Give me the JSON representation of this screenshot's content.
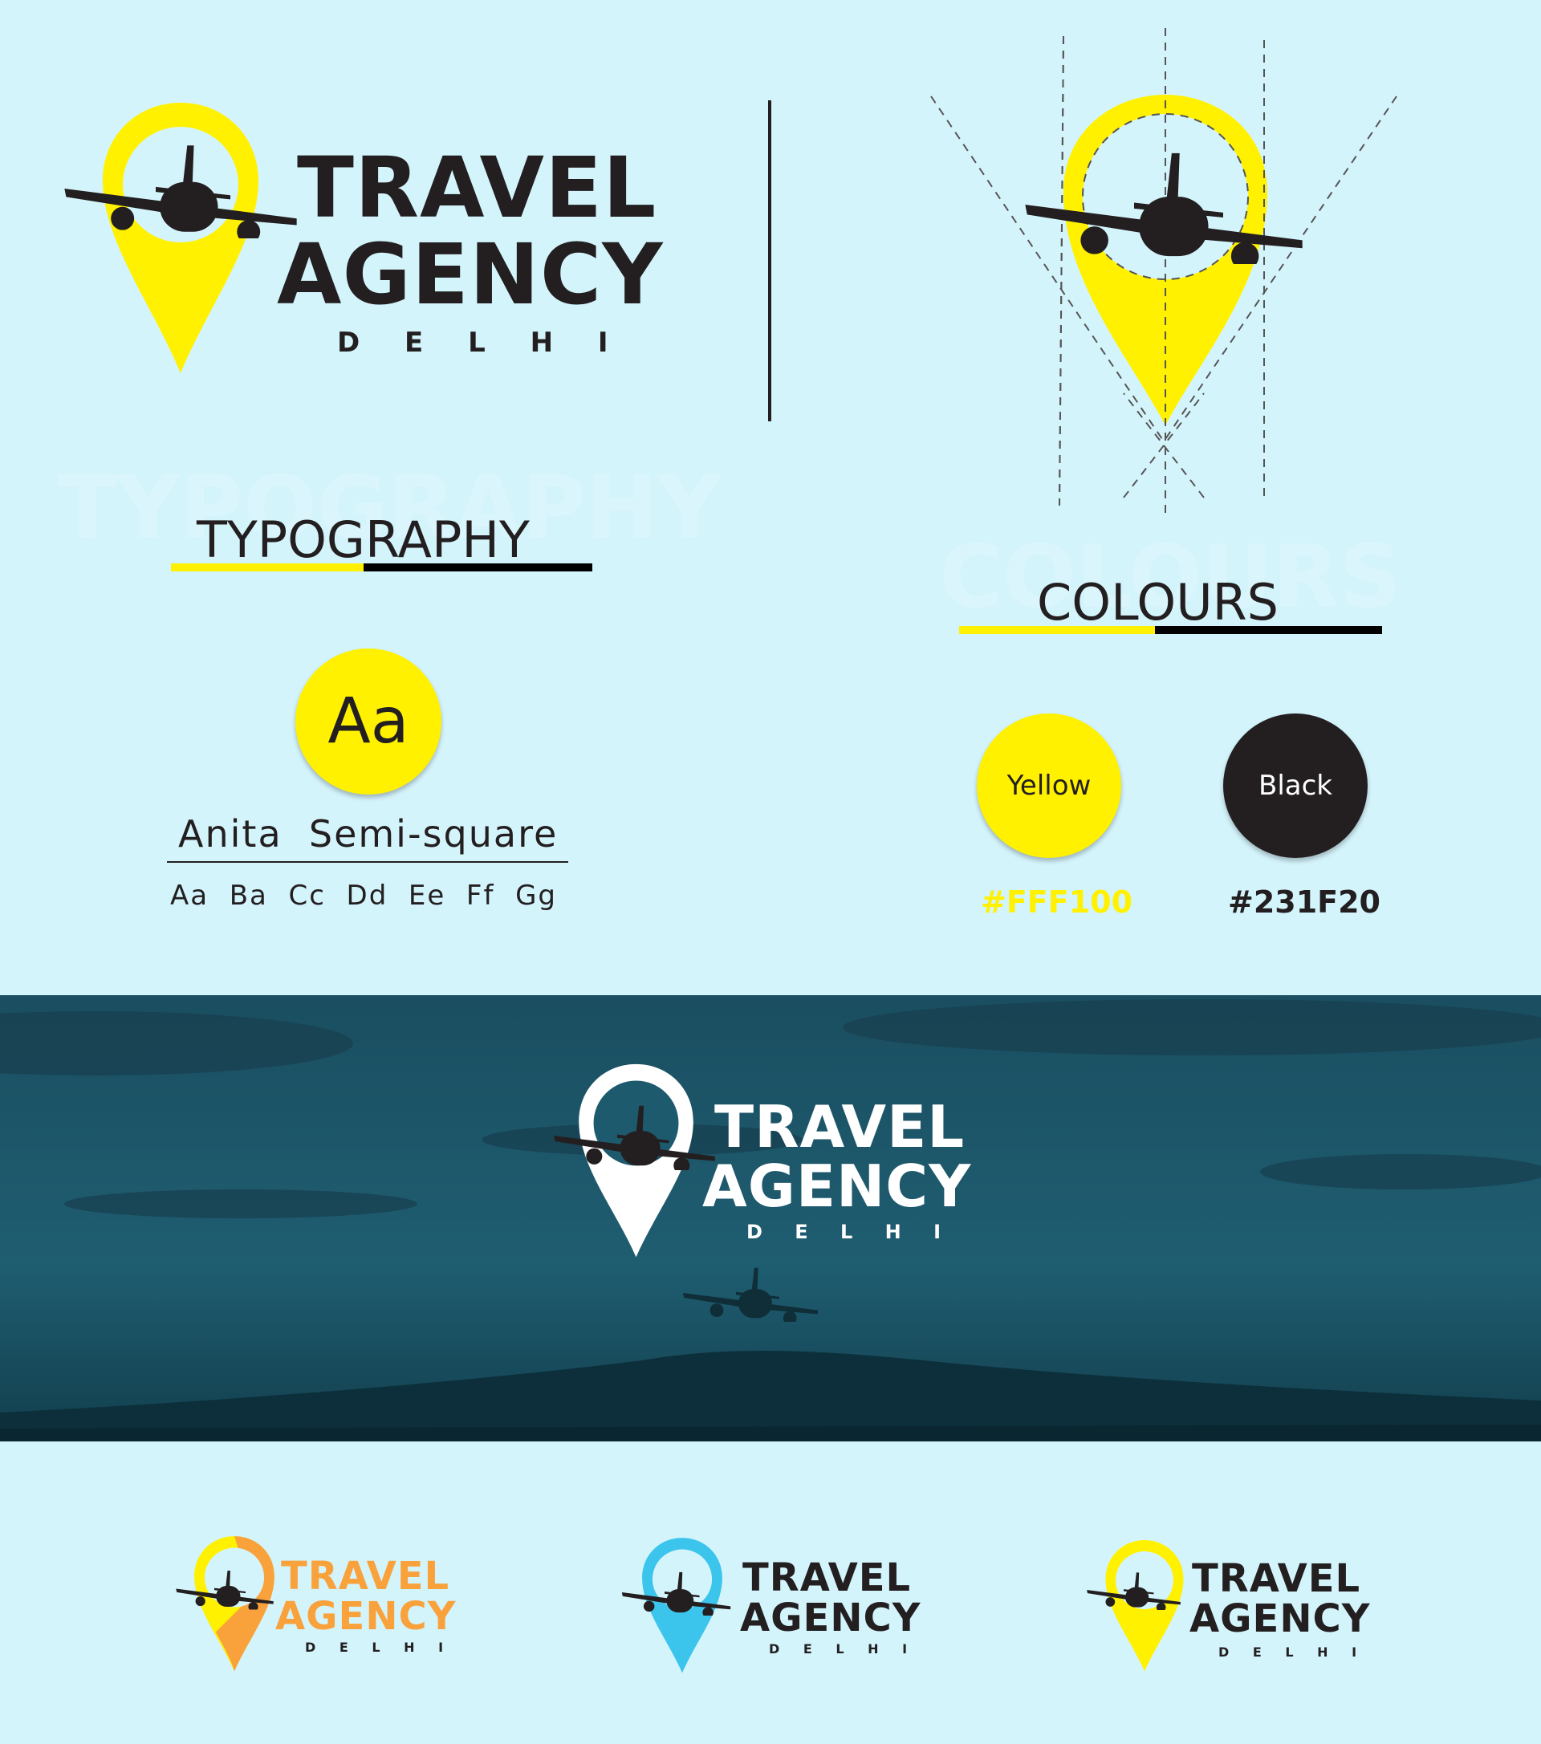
{
  "colors": {
    "background": "#d4f4fc",
    "yellow": "#FFF100",
    "black": "#231F20",
    "orange": "#f9a23c",
    "blue": "#3cc5ec",
    "banner_sky": "#1e5a6e"
  },
  "logo": {
    "line1": "TRAVEL",
    "line2": "AGENCY",
    "line3": "D E L H I"
  },
  "typography": {
    "ghost": "TYPOGRAPHY",
    "title": "TYPOGRAPHY",
    "sample": "Aa",
    "font_name": "Anita  Semi-square",
    "specimen": "Aa  Ba  Cc  Dd  Ee  Ff  Gg"
  },
  "colours": {
    "ghost": "COLOURS",
    "title": "COLOURS",
    "swatches": [
      {
        "label": "Yellow",
        "hex": "#FFF100"
      },
      {
        "label": "Black",
        "hex": "#231F20"
      }
    ]
  },
  "variants": [
    {
      "name": "orange",
      "pin": "#f9a23c",
      "text": "#f9a23c"
    },
    {
      "name": "blue",
      "pin": "#3cc5ec",
      "text": "#231F20"
    },
    {
      "name": "yellow",
      "pin": "#FFF100",
      "text": "#231F20"
    }
  ]
}
